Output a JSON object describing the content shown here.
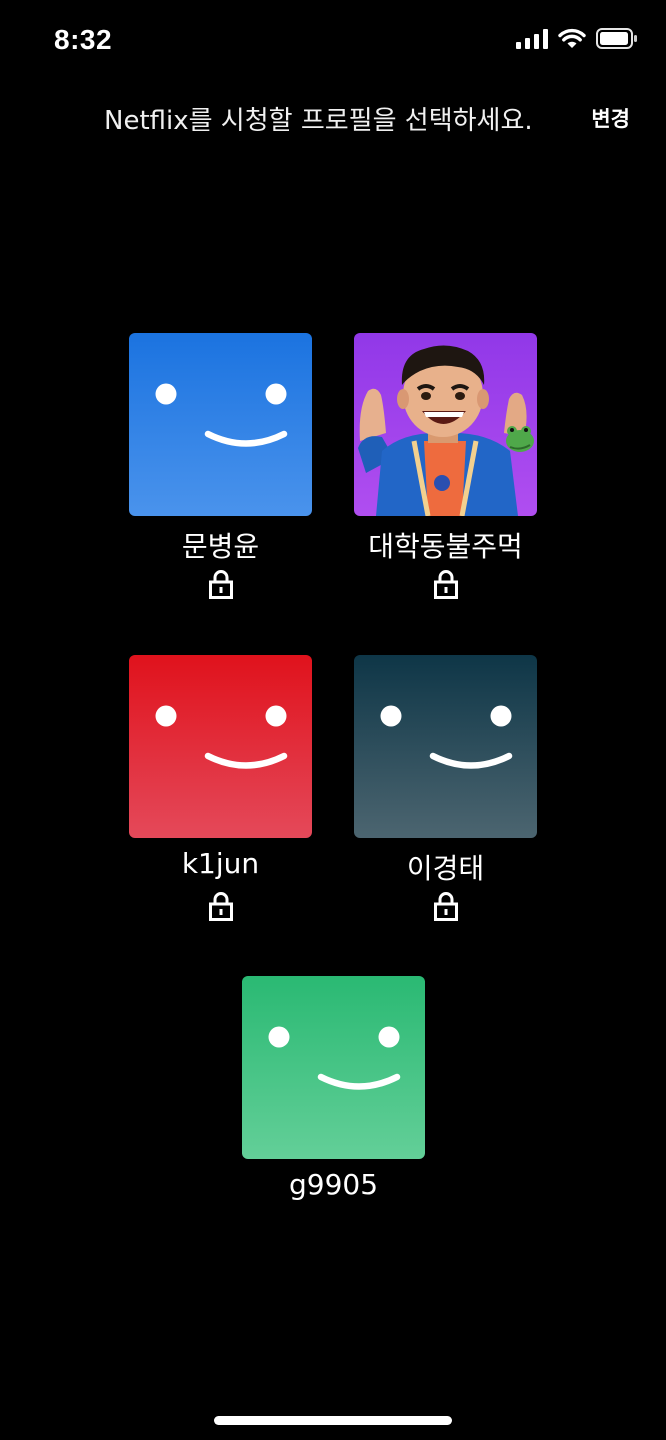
{
  "status_bar": {
    "time": "8:32",
    "icons": [
      "cellular-signal-icon",
      "wifi-icon",
      "battery-icon"
    ]
  },
  "header": {
    "title": "Netflix를 시청할 프로필을 선택하세요.",
    "edit_label": "변경"
  },
  "profiles": [
    {
      "name": "문병윤",
      "avatar": "blue-smiley",
      "color": "#1b73e0",
      "locked": true
    },
    {
      "name": "대학동불주먹",
      "avatar": "cartoon-boy-with-frog",
      "color": "#9138e8",
      "locked": true
    },
    {
      "name": "k1jun",
      "avatar": "red-smiley",
      "color": "#e0121c",
      "locked": true
    },
    {
      "name": "이경태",
      "avatar": "teal-smiley",
      "color": "#0e3647",
      "locked": true
    },
    {
      "name": "g9905",
      "avatar": "green-smiley",
      "color": "#2ab973",
      "locked": false
    }
  ]
}
